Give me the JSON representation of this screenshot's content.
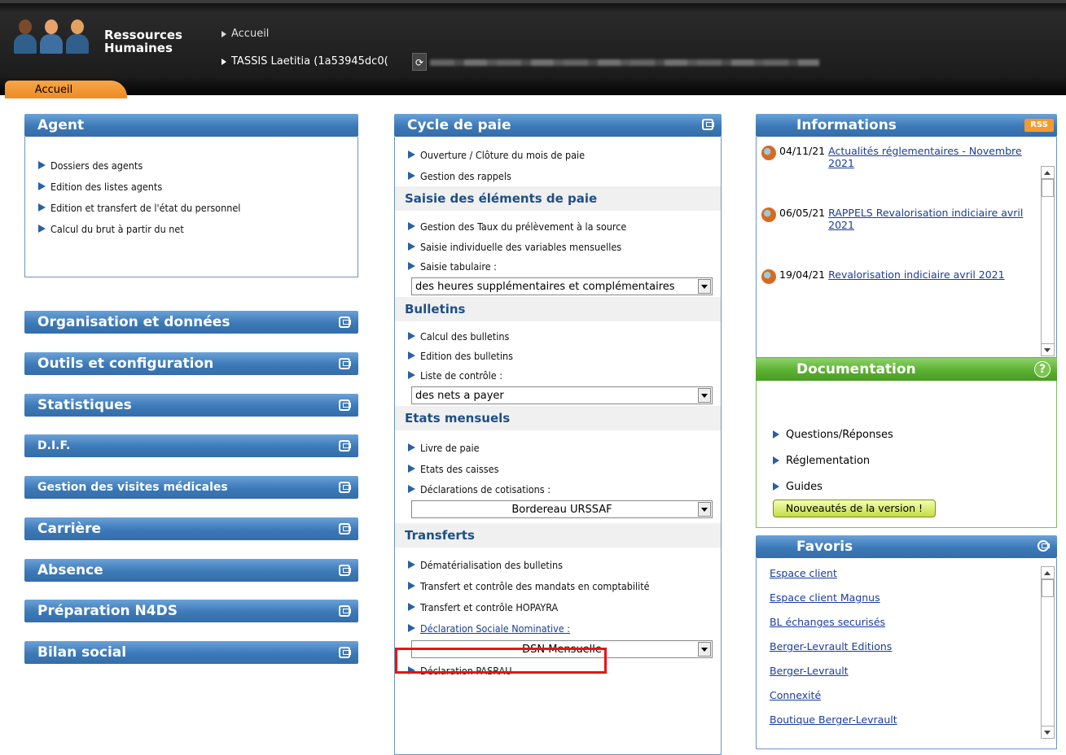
{
  "header": {
    "brand_line1": "Ressources",
    "brand_line2": "Humaines",
    "crumb_home": "Accueil",
    "crumb_user": "TASSIS Laetitia (1a53945dc0(",
    "tab_label": "Accueil"
  },
  "agent": {
    "title": "Agent",
    "items": [
      "Dossiers des agents",
      "Edition des listes agents",
      "Edition et transfert de l'état du personnel",
      "Calcul du brut à partir du net"
    ]
  },
  "collapsed_panels": [
    "Organisation et données",
    "Outils et configuration",
    "Statistiques",
    "D.I.F.",
    "Gestion des visites médicales",
    "Carrière",
    "Absence",
    "Préparation N4DS",
    "Bilan social"
  ],
  "cycle": {
    "title": "Cycle de paie",
    "items": [
      "Ouverture / Clôture du mois de paie",
      "Gestion des rappels"
    ],
    "saisie": {
      "title": "Saisie des éléments de paie",
      "items": [
        "Gestion des Taux du prélèvement à la source",
        "Saisie individuelle des variables mensuelles",
        "Saisie tabulaire :"
      ],
      "select": "des heures supplémentaires et complémentaires"
    },
    "bulletins": {
      "title": "Bulletins",
      "items": [
        "Calcul des bulletins",
        "Edition des bulletins",
        "Liste de contrôle :"
      ],
      "select": "des nets a payer"
    },
    "etats": {
      "title": "Etats mensuels",
      "items": [
        "Livre de paie",
        "Etats des caisses",
        "Déclarations de cotisations :"
      ],
      "select": "Bordereau URSSAF"
    },
    "transferts": {
      "title": "Transferts",
      "items": [
        "Dématérialisation des bulletins",
        "Transfert et contrôle des mandats en comptabilité",
        "Transfert et contrôle HOPAYRA"
      ],
      "dsn": "Déclaration Sociale Nominative :",
      "select": "DSN Mensuelle",
      "pasrau": "Déclaration PASRAU"
    }
  },
  "informations": {
    "title": "Informations",
    "rss": "RSS",
    "news": [
      {
        "date": "04/11/21",
        "text": "Actualités réglementaires - Novembre 2021"
      },
      {
        "date": "06/05/21",
        "text": "RAPPELS Revalorisation indiciaire avril 2021"
      },
      {
        "date": "19/04/21",
        "text": "Revalorisation indiciaire avril 2021"
      }
    ]
  },
  "documentation": {
    "title": "Documentation",
    "items": [
      "Questions/Réponses",
      "Réglementation",
      "Guides"
    ],
    "button": "Nouveautés de la version !"
  },
  "favoris": {
    "title": "Favoris",
    "items": [
      "Espace client",
      "Espace client Magnus",
      "BL échanges securisés",
      "Berger-Levrault Editions",
      "Berger-Levrault",
      "Connexité",
      "Boutique Berger-Levrault"
    ]
  }
}
